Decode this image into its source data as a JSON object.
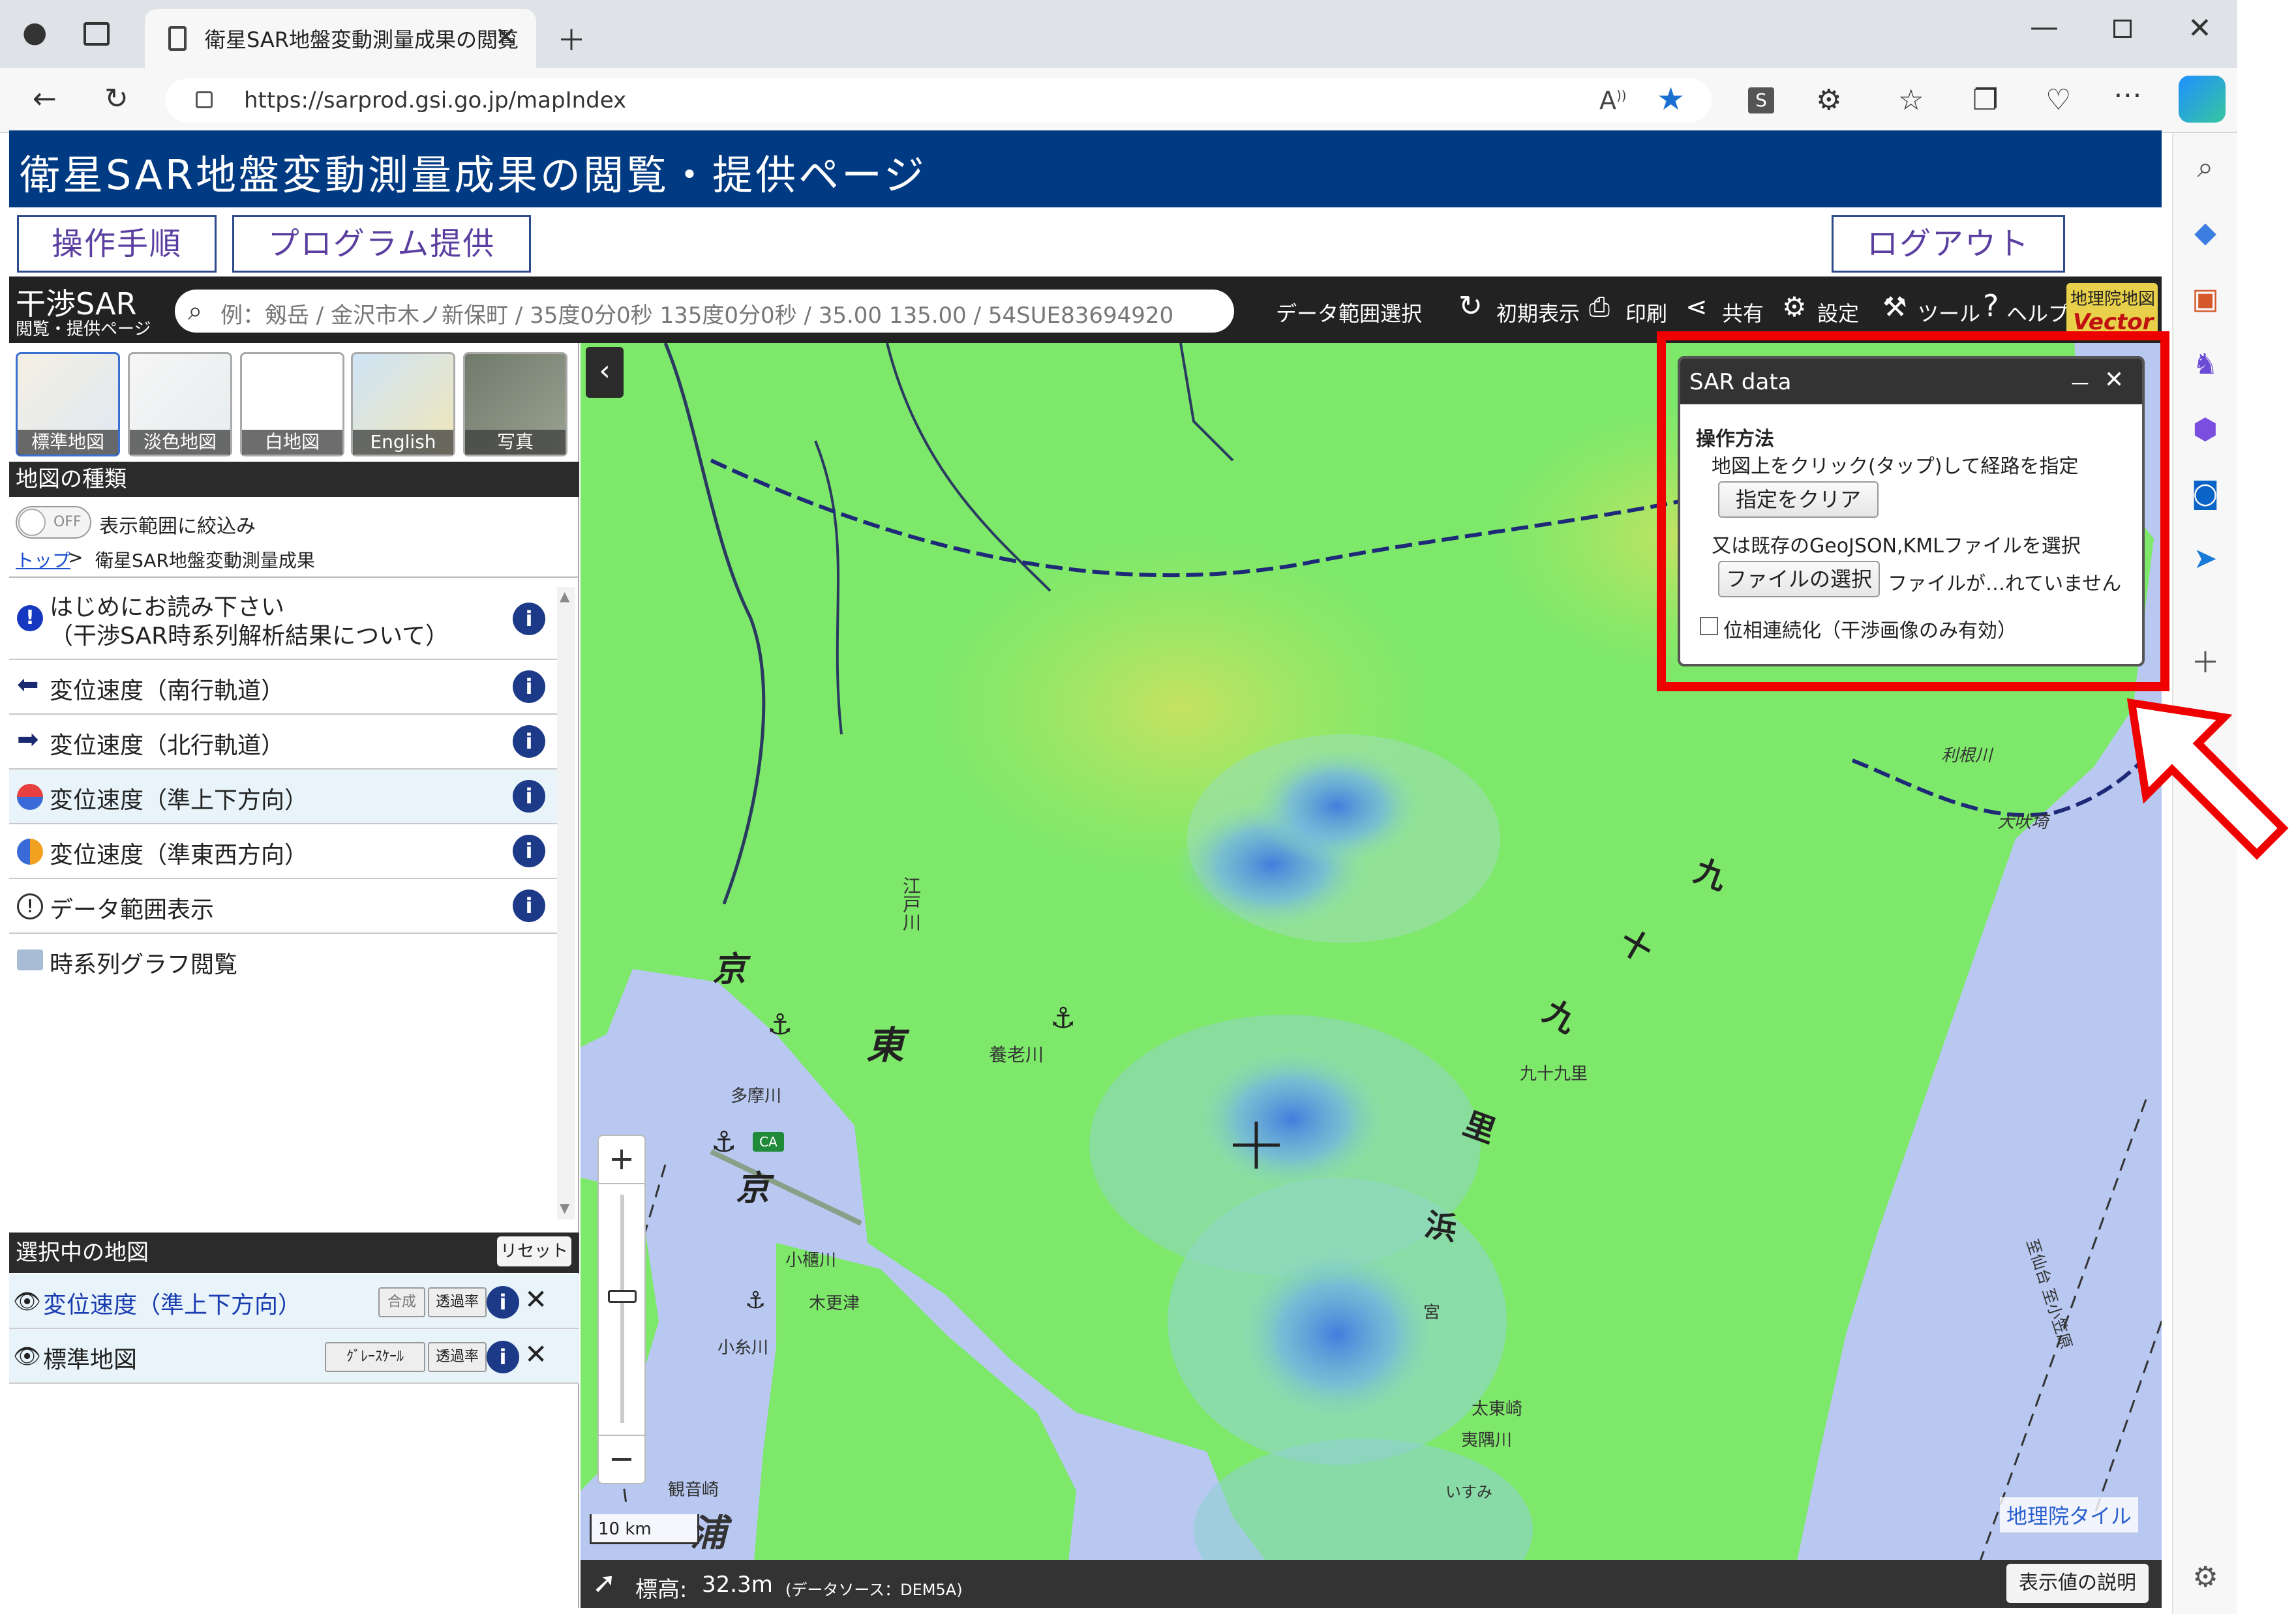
{
  "browser": {
    "tab_title": "衛星SAR地盤変動測量成果の閲覧",
    "url": "https://sarprod.gsi.go.jp/mapIndex"
  },
  "site": {
    "title": "衛星SAR地盤変動測量成果の閲覧・提供ページ",
    "nav": {
      "manual": "操作手順",
      "program": "プログラム提供",
      "logout": "ログアウト"
    }
  },
  "toolbar": {
    "logo_main": "干渉SAR",
    "logo_sub": "閲覧・提供ページ",
    "search_placeholder": "例：剱岳 / 金沢市木ノ新保町 / 35度0分0秒 135度0分0秒 / 35.00 135.00 / 54SUE83694920",
    "data_range": "データ範囲選択",
    "reset_view": "初期表示",
    "print": "印刷",
    "share": "共有",
    "settings": "設定",
    "tools": "ツール",
    "help": "ヘルプ",
    "vector_top": "地理院地図",
    "vector_bottom": "Vector"
  },
  "left": {
    "thumbnails": [
      "標準地図",
      "淡色地図",
      "白地図",
      "English",
      "写真"
    ],
    "map_types_header": "地図の種類",
    "toggle_off": "OFF",
    "toggle_label": "表示範囲に絞込み",
    "breadcrumb_top": "トップ",
    "breadcrumb_current": "衛星SAR地盤変動測量成果",
    "items": [
      {
        "label": "はじめにお読み下さい",
        "label2": "（干渉SAR時系列解析結果について）"
      },
      {
        "label": "変位速度（南行軌道）"
      },
      {
        "label": "変位速度（北行軌道）"
      },
      {
        "label": "変位速度（準上下方向）"
      },
      {
        "label": "変位速度（準東西方向）"
      },
      {
        "label": "データ範囲表示"
      },
      {
        "label": "時系列グラフ閲覧"
      }
    ],
    "selected_header": "選択中の地図",
    "reset": "リセット",
    "selected": [
      {
        "label": "変位速度（準上下方向）",
        "btn1": "合成",
        "btn2": "透過率"
      },
      {
        "label": "標準地図",
        "btn1": "ｸﾞﾚｰｽｹｰﾙ",
        "btn2": "透過率"
      }
    ]
  },
  "map": {
    "labels": [
      "江戸川",
      "京",
      "東",
      "養老川",
      "多摩川",
      "京",
      "小櫃川",
      "木更津",
      "小糸川",
      "利根川",
      "犬吠埼",
      "九十九里",
      "太東崎",
      "夷隅川",
      "宮",
      "いすみ",
      "観音崎",
      "浦",
      "九",
      "十",
      "九",
      "里",
      "浜",
      "至仙台 至小笠原",
      "CA",
      "浦"
    ],
    "scale": "10 km",
    "elevation_label": "標高:",
    "elevation_value": "32.3m",
    "elevation_source": "(データソース：DEM5A)",
    "tile_credit": "地理院タイル",
    "legend_button": "表示値の説明"
  },
  "sar_popup": {
    "title": "SAR data",
    "minimize": "－",
    "close": "✕",
    "section": "操作方法",
    "line1": "地図上をクリック(タップ)して経路を指定",
    "clear_button": "指定をクリア",
    "line2": "又は既存のGeoJSON,KMLファイルを選択",
    "file_button": "ファイルの選択",
    "file_status": "ファイルが…れていません",
    "checkbox_label": "位相連続化（干渉画像のみ有効）"
  },
  "colors": {
    "header_blue": "#003a82",
    "highlight_red": "#ef0000",
    "info_blue": "#1c3a88",
    "sar_green": "#7ee86a",
    "sea": "#b8c8f0"
  }
}
